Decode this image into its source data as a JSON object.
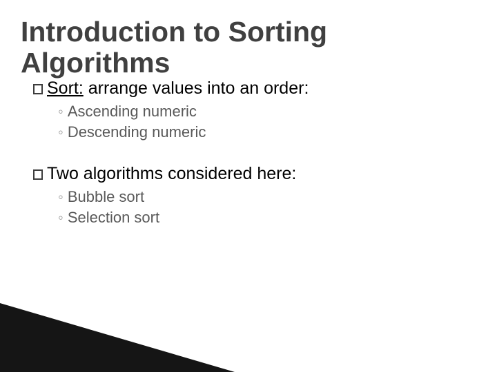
{
  "title": "Introduction to Sorting Algorithms",
  "points": [
    {
      "lead": "Sort:",
      "lead_underlined": true,
      "rest": " arrange values into an order:",
      "subs": [
        "Ascending numeric",
        "Descending numeric"
      ]
    },
    {
      "lead": "Two",
      "lead_underlined": false,
      "rest": " algorithms considered here:",
      "subs": [
        "Bubble sort",
        "Selection sort"
      ]
    }
  ]
}
